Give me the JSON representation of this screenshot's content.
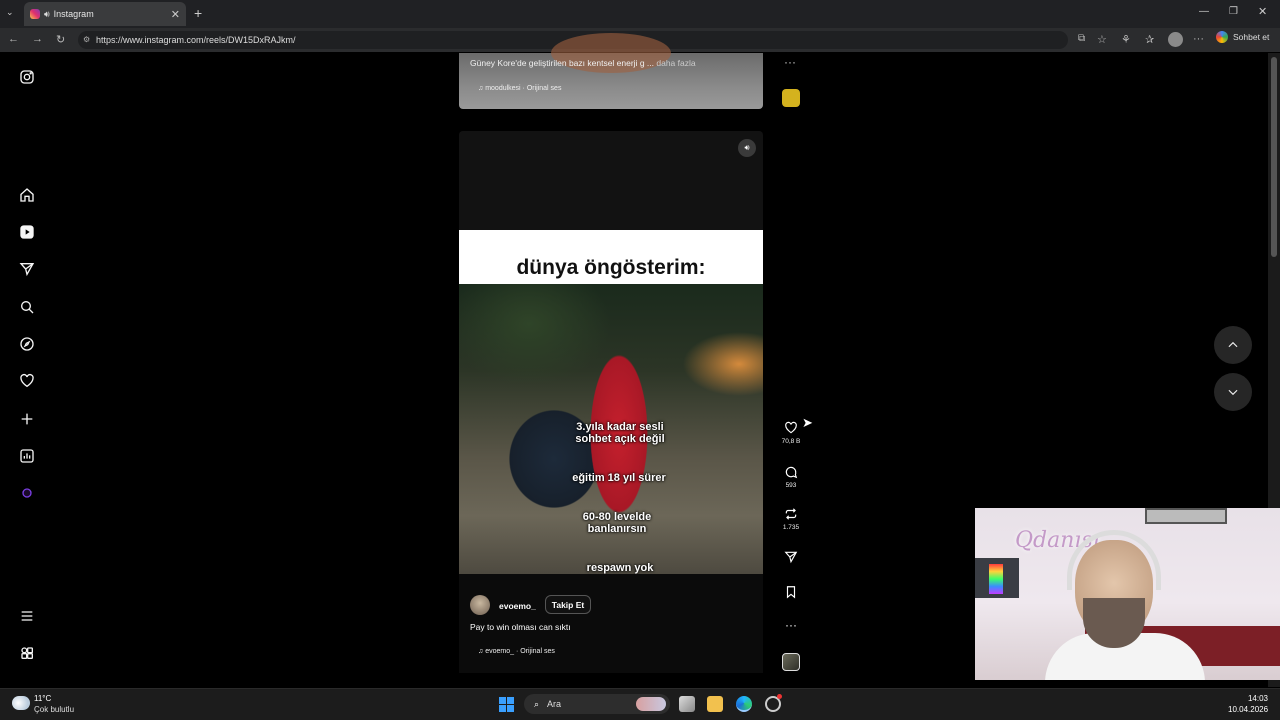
{
  "browser": {
    "tab_title": "Instagram",
    "url": "https://www.instagram.com/reels/DW15DxRAJkm/",
    "chat_label": "Sohbet et"
  },
  "prev_reel": {
    "caption": "Güney Kore'de geliştirilen bazı kentsel enerji g ...",
    "more_label": "daha fazla",
    "audio": "moodulkesi · Orijinal ses"
  },
  "reel": {
    "title_overlay": "dünya öngösterim:",
    "overlay_1_line1": "3.yıla kadar sesli",
    "overlay_1_line2": "sohbet açık değil",
    "overlay_2": "eğitim 18 yıl sürer",
    "overlay_3_line1": "60-80 levelde",
    "overlay_3_line2": "banlanırsın",
    "overlay_4": "respawn yok",
    "username": "evoemo_",
    "follow_label": "Takip Et",
    "caption": "Pay to win olması can sıktı",
    "audio": "evoemo_ · Orijinal ses",
    "likes": "70,8 B",
    "comments": "593",
    "reposts": "1.735"
  },
  "taskbar": {
    "temperature": "11°C",
    "condition": "Çok bulutlu",
    "search_label": "Ara",
    "time": "14:03",
    "date": "10.04.2026"
  },
  "colors": {
    "background": "#000000",
    "accent_windows": "#3aa0ff"
  }
}
